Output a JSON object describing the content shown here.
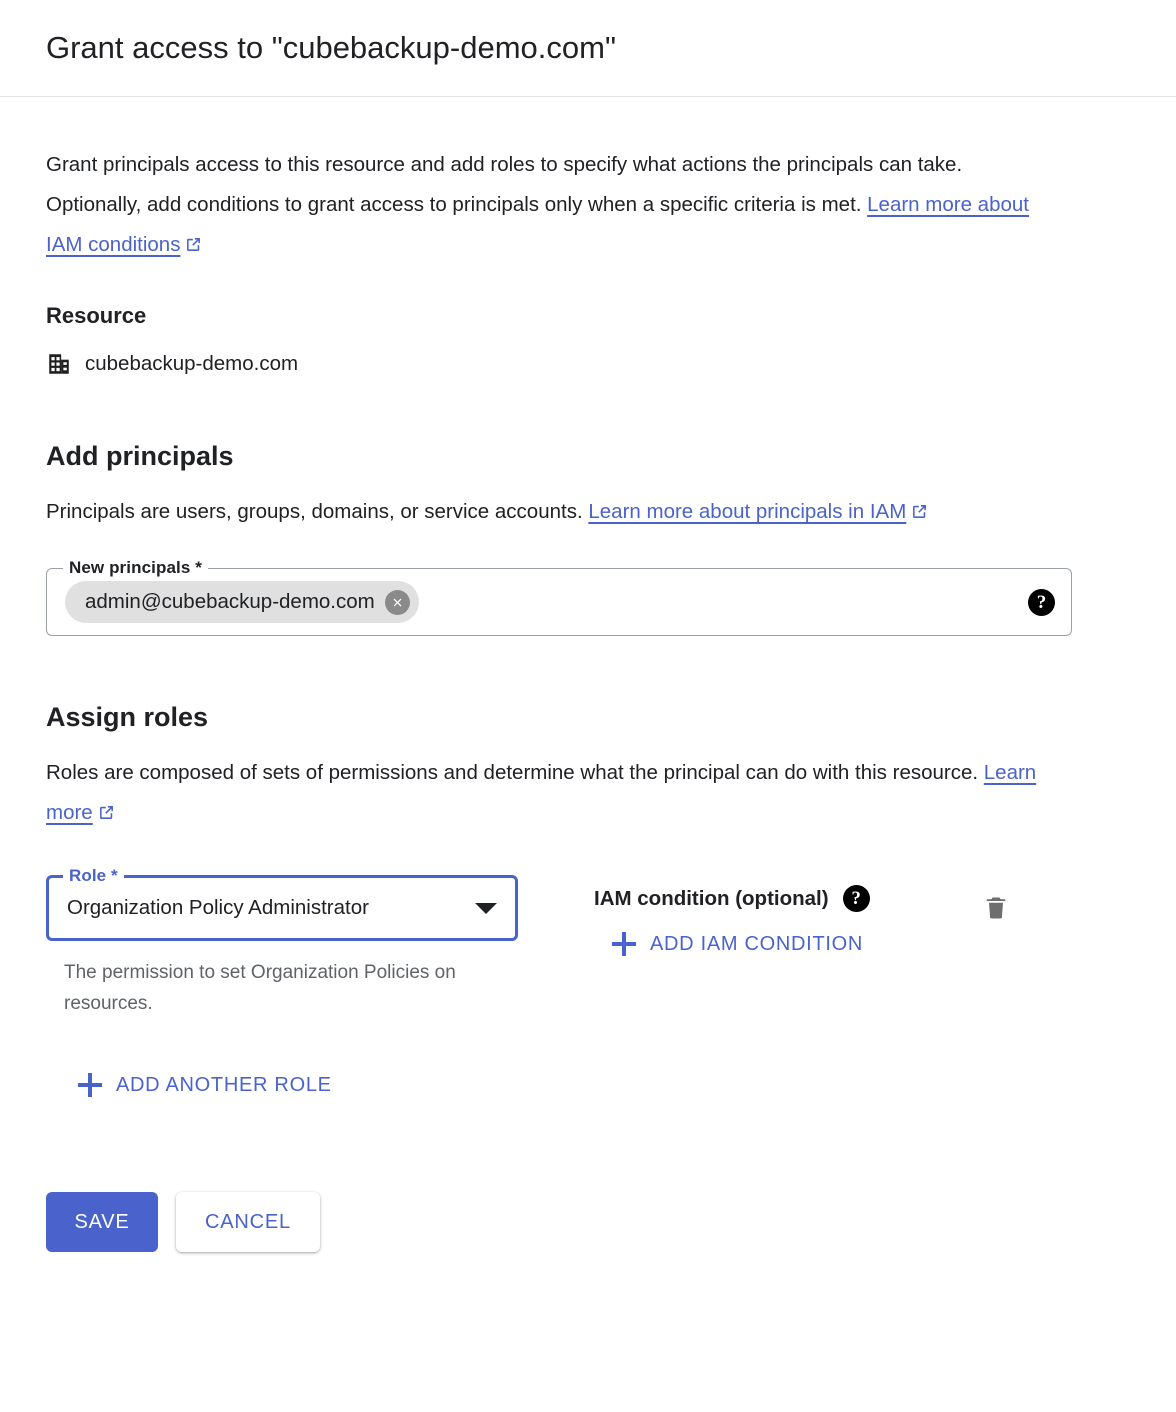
{
  "dialog": {
    "title": "Grant access to \"cubebackup-demo.com\"",
    "intro_text_1": "Grant principals access to this resource and add roles to specify what actions the principals can take. Optionally, add conditions to grant access to principals only when a specific criteria is met. ",
    "intro_link": "Learn more about IAM conditions"
  },
  "resource": {
    "heading": "Resource",
    "icon": "domain-icon",
    "name": "cubebackup-demo.com"
  },
  "principals": {
    "heading": "Add principals",
    "description": "Principals are users, groups, domains, or service accounts. ",
    "description_link": "Learn more about principals in IAM",
    "field_label": "New principals *",
    "chips": [
      {
        "label": "admin@cubebackup-demo.com",
        "remove_icon": "close-circle-icon"
      }
    ],
    "help_icon": "help-icon",
    "placeholder": ""
  },
  "roles": {
    "heading": "Assign roles",
    "description": "Roles are composed of sets of permissions and determine what the principal can do with this resource. ",
    "description_link": "Learn more",
    "role_field_label": "Role *",
    "role_selected": "Organization Policy Administrator",
    "role_hint": "The permission to set Organization Policies on resources.",
    "condition_label": "IAM condition (optional)",
    "condition_help_icon": "help-icon",
    "add_condition_label": "ADD IAM CONDITION",
    "delete_icon": "trash-icon",
    "add_role_label": "ADD ANOTHER ROLE"
  },
  "footer": {
    "save_label": "SAVE",
    "cancel_label": "CANCEL"
  },
  "colors": {
    "accent_blue": "#4a63cc",
    "text_primary": "#202124",
    "text_secondary": "#5f6368",
    "chip_bg": "#e0e0e0",
    "border": "#9aa0a6"
  }
}
